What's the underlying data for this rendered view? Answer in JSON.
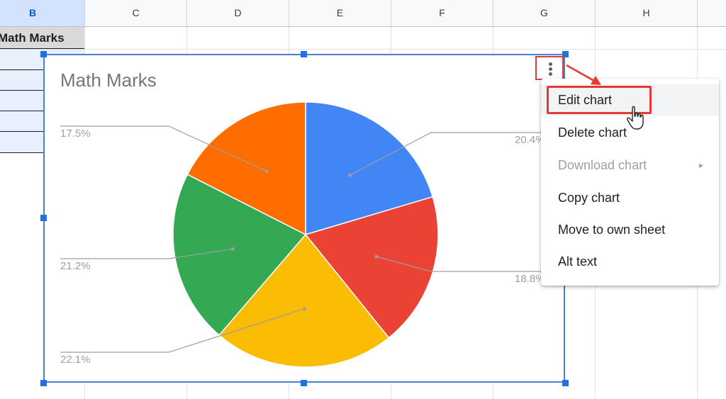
{
  "columns": [
    "B",
    "C",
    "D",
    "E",
    "F",
    "G",
    "H"
  ],
  "selected_column": "B",
  "cell_b_header": "Math Marks",
  "chart": {
    "title": "Math Marks",
    "menu_icon": "more-vert-icon"
  },
  "chart_data": {
    "type": "pie",
    "title": "Math Marks",
    "slices": [
      {
        "label": "20.4%",
        "value": 20.4,
        "color": "#4285f4"
      },
      {
        "label": "18.8%",
        "value": 18.8,
        "color": "#ea4335"
      },
      {
        "label": "22.1%",
        "value": 22.1,
        "color": "#fbbc04"
      },
      {
        "label": "21.2%",
        "value": 21.2,
        "color": "#34a853"
      },
      {
        "label": "17.5%",
        "value": 17.5,
        "color": "#ff6d01"
      }
    ],
    "legend": "none",
    "labels_position": "outside"
  },
  "context_menu": {
    "items": [
      {
        "label": "Edit chart",
        "state": "hover"
      },
      {
        "label": "Delete chart",
        "state": "normal"
      },
      {
        "label": "Download chart",
        "state": "disabled",
        "submenu": "▸"
      },
      {
        "label": "Copy chart",
        "state": "normal"
      },
      {
        "label": "Move to own sheet",
        "state": "normal"
      },
      {
        "label": "Alt text",
        "state": "normal"
      }
    ]
  },
  "annotations": {
    "highlight_color": "#e53935",
    "cursor_icon": "hand-pointer-icon"
  }
}
